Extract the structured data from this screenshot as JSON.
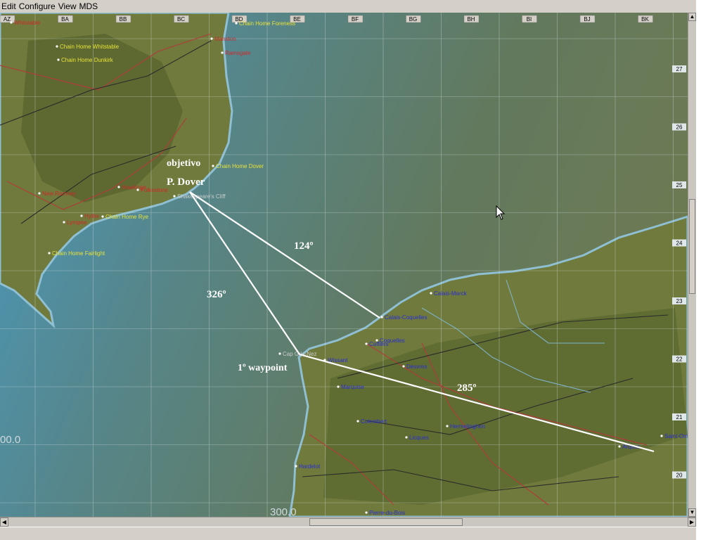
{
  "menu": [
    "Edit",
    "Configure",
    "View",
    "MDS"
  ],
  "grid": {
    "columns": [
      "AZ",
      "BA",
      "BB",
      "BC",
      "BD",
      "BE",
      "BF",
      "BG",
      "BH",
      "BI",
      "BJ",
      "BK"
    ],
    "rows": [
      "27",
      "26",
      "25",
      "24",
      "23",
      "22",
      "21",
      "20"
    ],
    "coord_labels": [
      "00.0",
      "300.0"
    ]
  },
  "places": {
    "yellow": [
      "Chain Home Foreness",
      "Chain Home Whitstable",
      "Chain Home Dunkirk",
      "Chain Home Dover",
      "Chain Home Rye",
      "Chain Home Fairlight"
    ],
    "blue": [
      "Calais-Marck",
      "Calais-Coquelles",
      "Coquelles",
      "Caffiers",
      "Marquise",
      "Hermelinghen",
      "Colembert",
      "Licques",
      "Saint-Omer",
      "Arques",
      "Wissant",
      "Desvres",
      "Pierre-du-Bois",
      "Hardelot"
    ],
    "red": [
      "Hawkinge",
      "Manston",
      "Lympne",
      "Hythe",
      "Whitstable",
      "New Romney",
      "Folkestone",
      "Ramsgate"
    ],
    "grey": [
      "Shakespeare's Cliff",
      "Cap Gris-Nez"
    ]
  },
  "annotations": {
    "objective": "objetivo",
    "target": "P. Dover",
    "waypoint": "1º waypoint",
    "heading_1": "124º",
    "heading_2": "326º",
    "heading_3": "285º"
  },
  "colors": {
    "sea": "#3f8fb4",
    "land": "#6f7a3c",
    "route": "#ffffff",
    "grid": "#d8e2e6"
  }
}
